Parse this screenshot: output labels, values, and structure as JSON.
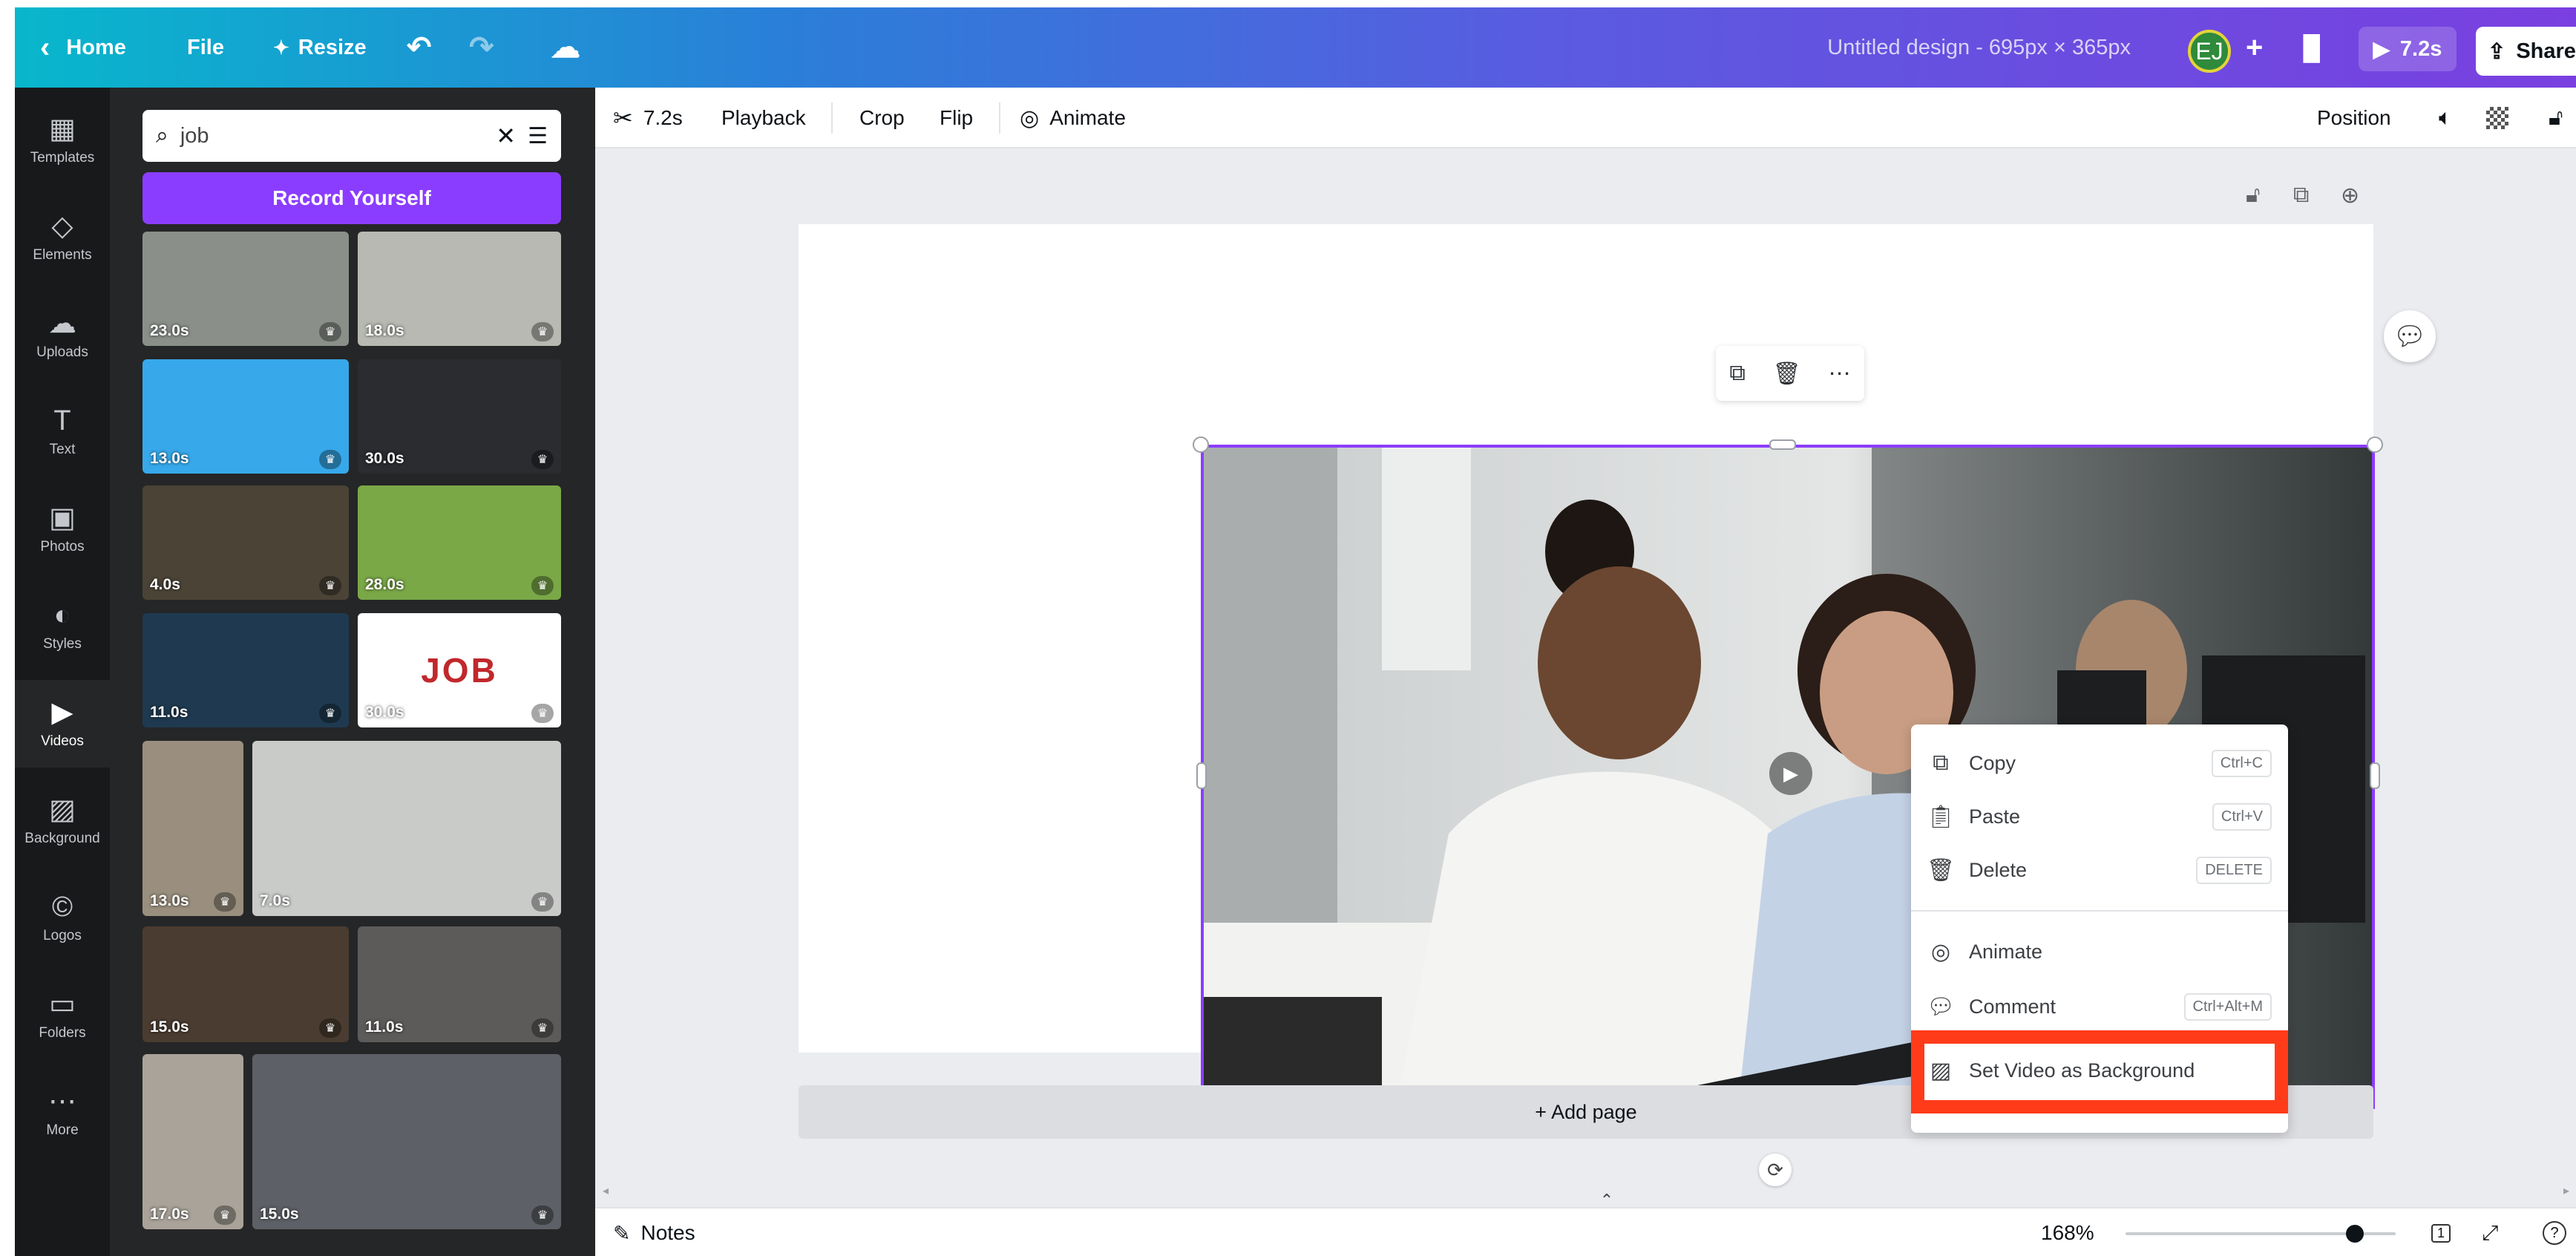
{
  "topbar": {
    "home": "Home",
    "file": "File",
    "resize": "Resize",
    "title": "Untitled design - 695px × 365px",
    "avatar": "EJ",
    "duration": "7.2s",
    "share": "Share"
  },
  "rail": [
    {
      "label": "Templates",
      "icon": "templates-icon"
    },
    {
      "label": "Elements",
      "icon": "elements-icon"
    },
    {
      "label": "Uploads",
      "icon": "uploads-icon"
    },
    {
      "label": "Text",
      "icon": "text-icon"
    },
    {
      "label": "Photos",
      "icon": "photos-icon"
    },
    {
      "label": "Styles",
      "icon": "styles-icon"
    },
    {
      "label": "Videos",
      "icon": "videos-icon"
    },
    {
      "label": "Background",
      "icon": "background-icon"
    },
    {
      "label": "Logos",
      "icon": "logos-icon"
    },
    {
      "label": "Folders",
      "icon": "folders-icon"
    },
    {
      "label": "More",
      "icon": "more-icon"
    }
  ],
  "panel": {
    "search_value": "job",
    "record_label": "Record Yourself",
    "videos": [
      {
        "duration": "23.0s",
        "color": "#8a8f8a"
      },
      {
        "duration": "18.0s",
        "color": "#b7b9b2"
      },
      {
        "duration": "13.0s",
        "color": "#37a8ea"
      },
      {
        "duration": "30.0s",
        "color": "#2a2c30"
      },
      {
        "duration": "4.0s",
        "color": "#4a4336"
      },
      {
        "duration": "28.0s",
        "color": "#7aa847"
      },
      {
        "duration": "11.0s",
        "color": "#1f3a50"
      },
      {
        "duration": "30.0s",
        "color": "#ffffff",
        "text": "JOB"
      },
      {
        "duration": "13.0s",
        "color": "#9a8f7e"
      },
      {
        "duration": "7.0s",
        "color": "#c9cbc9"
      },
      {
        "duration": "15.0s",
        "color": "#4a3c30"
      },
      {
        "duration": "11.0s",
        "color": "#5d5b5a"
      },
      {
        "duration": "17.0s",
        "color": "#a9a39a"
      },
      {
        "duration": "15.0s",
        "color": "#5d6066"
      }
    ]
  },
  "toolbar": {
    "duration": "7.2s",
    "playback": "Playback",
    "crop": "Crop",
    "flip": "Flip",
    "animate": "Animate",
    "position": "Position"
  },
  "canvas": {
    "add_page": "+ Add page"
  },
  "context_menu": {
    "items": [
      {
        "label": "Copy",
        "shortcut": "Ctrl+C",
        "icon": "copy-icon"
      },
      {
        "label": "Paste",
        "shortcut": "Ctrl+V",
        "icon": "paste-icon"
      },
      {
        "label": "Delete",
        "shortcut": "DELETE",
        "icon": "trash-icon"
      },
      {
        "label": "Animate",
        "shortcut": "",
        "icon": "animate-icon"
      },
      {
        "label": "Comment",
        "shortcut": "Ctrl+Alt+M",
        "icon": "comment-icon"
      },
      {
        "label": "Set Video as Background",
        "shortcut": "",
        "icon": "background-icon"
      }
    ],
    "highlight_color": "#ff3b1a"
  },
  "bottombar": {
    "notes": "Notes",
    "zoom": "168%",
    "zoom_level": 0.85,
    "page_count": "1"
  },
  "colors": {
    "accent": "#8b3dff",
    "rail_bg": "#18191b",
    "panel_bg": "#252627"
  }
}
